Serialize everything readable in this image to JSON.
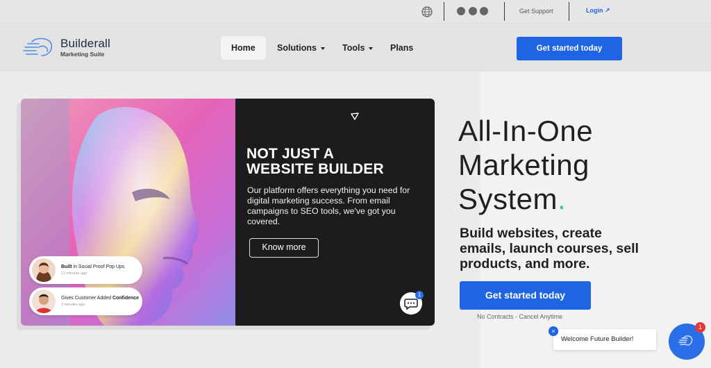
{
  "topbar": {
    "get_support": "Get Support",
    "login": "Login ↗",
    "icons": [
      "globe-icon",
      "email-icon",
      "facebook-icon",
      "instagram-icon"
    ]
  },
  "brand": {
    "name": "Builderall",
    "tagline": "Marketing Suite",
    "accent": "#1f64e2",
    "teal": "#2cc7b0"
  },
  "nav": {
    "items": [
      {
        "label": "Home",
        "active": true
      },
      {
        "label": "Solutions",
        "dropdown": true
      },
      {
        "label": "Tools",
        "dropdown": true
      },
      {
        "label": "Plans"
      }
    ],
    "cta": "Get started today"
  },
  "card": {
    "title_line1": "NOT JUST A",
    "title_line2": "WEBSITE BUILDER",
    "body": "Our platform offers everything you need for digital marketing success. From email campaigns to SEO tools, we've got you covered.",
    "button": "Know more",
    "chat_badge": "1"
  },
  "proofs": [
    {
      "strong": "Built",
      "text": " in Social Proof Pop Ups",
      "time": "11 minutes ago"
    },
    {
      "text": "Gives Customer Added ",
      "strong": "Confidence",
      "time": "3 minutes ago"
    }
  ],
  "hero": {
    "line1": "All-In-One",
    "line2": "Marketing",
    "line3": "System",
    "line3_dot": ".",
    "subhead": "Build websites, create emails, launch courses, sell products, and more.",
    "cta": "Get started today",
    "note": "No Contracts - Cancel Anytime"
  },
  "chat_widget": {
    "welcome": "Welcome Future Builder!",
    "close": "×",
    "badge": "1"
  }
}
